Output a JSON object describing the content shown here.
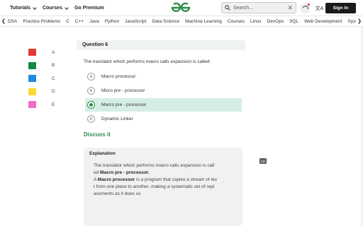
{
  "nav": {
    "tutorials": "Tutorials",
    "courses": "Courses",
    "go_premium": "Go Premium",
    "search_placeholder": "Search...",
    "translate_glyph": "文A",
    "sign_in": "Sign In"
  },
  "categories": [
    "DSA",
    "Practice Problems",
    "C",
    "C++",
    "Java",
    "Python",
    "JavaScript",
    "Data Science",
    "Machine Learning",
    "Courses",
    "Linux",
    "DevOps",
    "SQL",
    "Web Development",
    "System Design"
  ],
  "legend": [
    {
      "label": "A",
      "color": "#e53935"
    },
    {
      "label": "B",
      "color": "#138a43"
    },
    {
      "label": "C",
      "color": "#1e88e5"
    },
    {
      "label": "D",
      "color": "#fdd835"
    },
    {
      "label": "E",
      "color": "#f06fc8"
    }
  ],
  "question": {
    "title": "Question 6",
    "text": "The translator which performs macro calls expansion is called:",
    "options": [
      {
        "key": "A",
        "text": "Macro processor",
        "selected": false
      },
      {
        "key": "B",
        "text": "Micro pre - processor",
        "selected": false
      },
      {
        "key": "C",
        "text": "Macro pre - processor",
        "selected": true
      },
      {
        "key": "D",
        "text": "Dynamic Linker",
        "selected": false
      }
    ],
    "discuss": "Discuss it"
  },
  "explanation": {
    "title": "Explanation",
    "line1_a": "The translator which performs macro calls expansion is call",
    "line1_b": "ed ",
    "line1_bold": "Macro pre - processor.",
    "line2_a": "A ",
    "line2_bold": "Macro processor",
    "line2_b": " is a program that copies a stream of tex",
    "line3": "t from one place to another, making a systematic set of repl",
    "line4": "acements as it does so"
  },
  "ad_label": "AD",
  "colors": {
    "brand_green": "#2f8d46",
    "selected_bg": "#d6ede6"
  }
}
